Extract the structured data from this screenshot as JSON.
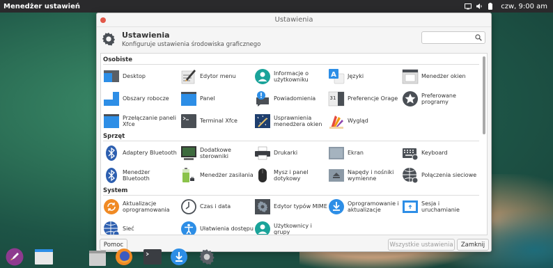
{
  "topbar": {
    "app_title": "Menedżer ustawień",
    "clock": "czw, 9:00 am"
  },
  "window": {
    "title": "Ustawienia",
    "header_title": "Ustawienia",
    "header_subtitle": "Konfiguruje ustawienia środowiska graficznego",
    "search_placeholder": ""
  },
  "sections": {
    "personal": "Osobiste",
    "hardware": "Sprzęt",
    "system": "System"
  },
  "items": {
    "desktop": "Desktop",
    "menu_editor": "Edytor menu",
    "user_info": "Informacje o użytkowniku",
    "languages": "Języki",
    "window_manager": "Menedżer okien",
    "workspaces": "Obszary robocze",
    "panel": "Panel",
    "notifications": "Powiadomienia",
    "orage_prefs": "Preferencje Orage",
    "preferred_apps": "Preferowane programy",
    "xfce_panel_switch": "Przełączanie paneli Xfce",
    "xfce_terminal": "Terminal Xfce",
    "wm_tweaks": "Usprawnienia menedżera okien",
    "appearance": "Wygląd",
    "bt_adapters": "Adaptery Bluetooth",
    "additional_drivers": "Dodatkowe sterowniki",
    "printers": "Drukarki",
    "display": "Ekran",
    "keyboard": "Keyboard",
    "bt_manager": "Menedżer Bluetooth",
    "power_manager": "Menedżer zasilania",
    "mouse_touchpad": "Mysz i panel dotykowy",
    "removable_drives": "Napędy i nośniki wymienne",
    "network_connections": "Połączenia sieciowe",
    "software_updater": "Aktualizacje oprogramowania",
    "time_date": "Czas i data",
    "mime_editor": "Edytor typów MIME",
    "software_updates": "Oprogramowanie i aktualizacje",
    "session_startup": "Sesja i uruchamianie",
    "network": "Sieć",
    "accessibility": "Ułatwienia dostępu",
    "users_groups": "Użytkownicy i grupy"
  },
  "buttons": {
    "help": "Pomoc",
    "all_settings": "Wszystkie ustawienia",
    "close": "Zamknij"
  },
  "colors": {
    "accent_blue": "#2d8ee6",
    "teal": "#1aa39a",
    "close_dot": "#e25849"
  }
}
